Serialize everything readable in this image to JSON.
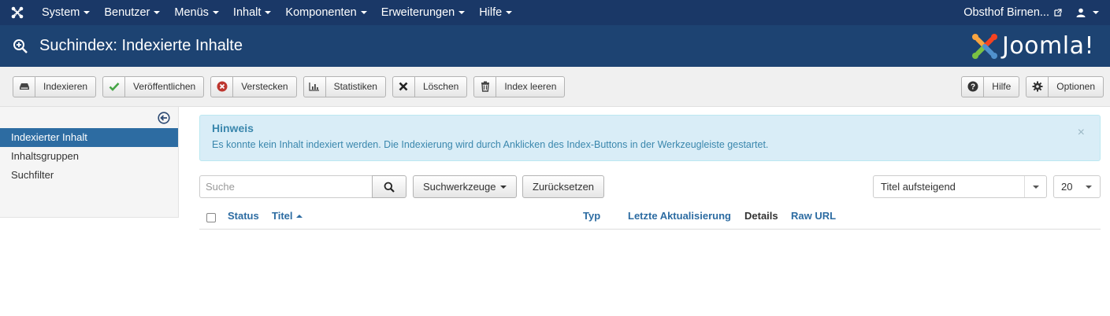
{
  "topnav": {
    "menu": [
      {
        "label": "System"
      },
      {
        "label": "Benutzer"
      },
      {
        "label": "Menüs"
      },
      {
        "label": "Inhalt"
      },
      {
        "label": "Komponenten"
      },
      {
        "label": "Erweiterungen"
      },
      {
        "label": "Hilfe"
      }
    ],
    "site_name": "Obsthof Birnen...",
    "user_icon": "user-icon"
  },
  "subhead": {
    "title": "Suchindex: Indexierte Inhalte",
    "brand": "Joomla!",
    "icon": "zoom-in-icon"
  },
  "toolbar": {
    "buttons": [
      {
        "label": "Indexieren",
        "icon": "drive-icon"
      },
      {
        "label": "Veröffentlichen",
        "icon": "check-icon"
      },
      {
        "label": "Verstecken",
        "icon": "cancel-circle-icon"
      },
      {
        "label": "Statistiken",
        "icon": "bar-chart-icon"
      },
      {
        "label": "Löschen",
        "icon": "x-icon"
      },
      {
        "label": "Index leeren",
        "icon": "trash-icon"
      }
    ],
    "help_label": "Hilfe",
    "options_label": "Optionen"
  },
  "sidebar": {
    "items": [
      {
        "label": "Indexierter Inhalt",
        "active": true
      },
      {
        "label": "Inhaltsgruppen",
        "active": false
      },
      {
        "label": "Suchfilter",
        "active": false
      }
    ]
  },
  "alert": {
    "heading": "Hinweis",
    "message": "Es konnte kein Inhalt indexiert werden. Die Indexierung wird durch Anklicken des Index-Buttons in der Werkzeugleiste gestartet.",
    "close": "×"
  },
  "filters": {
    "search_placeholder": "Suche",
    "search_tools_label": "Suchwerkzeuge",
    "reset_label": "Zurücksetzen",
    "ordering_value": "Titel aufsteigend",
    "limit_value": "20"
  },
  "table": {
    "headers": {
      "status": "Status",
      "title": "Titel",
      "type": "Typ",
      "last_update": "Letzte Aktualisierung",
      "details": "Details",
      "raw_url": "Raw URL"
    }
  },
  "colors": {
    "topnav_bg": "#1a3867",
    "subhead_bg": "#1d4372",
    "accent": "#2d6ca2",
    "alert_bg": "#d9edf7"
  }
}
